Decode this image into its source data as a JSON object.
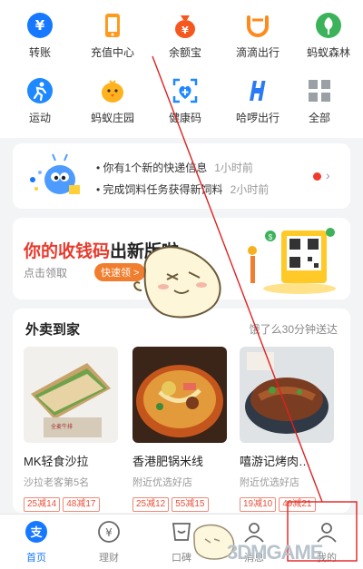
{
  "apps_row1": [
    {
      "label": "转账",
      "icon": "transfer-icon"
    },
    {
      "label": "充值中心",
      "icon": "phone-recharge-icon"
    },
    {
      "label": "余额宝",
      "icon": "money-bag-icon"
    },
    {
      "label": "滴滴出行",
      "icon": "didi-icon"
    },
    {
      "label": "蚂蚁森林",
      "icon": "forest-icon"
    }
  ],
  "apps_row2": [
    {
      "label": "运动",
      "icon": "sport-icon"
    },
    {
      "label": "蚂蚁庄园",
      "icon": "chick-icon"
    },
    {
      "label": "健康码",
      "icon": "health-code-icon"
    },
    {
      "label": "哈啰出行",
      "icon": "hello-icon"
    },
    {
      "label": "全部",
      "icon": "all-grid-icon"
    }
  ],
  "messages": [
    {
      "text": "你有1个新的快递信息",
      "time": "1小时前"
    },
    {
      "text": "完成饲料任务获得新饲料",
      "time": "2小时前"
    }
  ],
  "promo": {
    "title_colored": "你的收钱码",
    "title_plain": "出新版啦",
    "subtitle": "点击领取",
    "button": "快速领 >"
  },
  "food": {
    "title": "外卖到家",
    "subtitle": "饿了么30分钟送达",
    "items": [
      {
        "name": "MK轻食沙拉",
        "shop": "沙拉老客第5名",
        "tags": [
          "25减14",
          "48减17"
        ]
      },
      {
        "name": "香港肥锅米线",
        "shop": "附近优选好店",
        "tags": [
          "25减12",
          "55减15"
        ]
      },
      {
        "name": "嘻游记烤肉…",
        "shop": "附近优选好店",
        "tags": [
          "19减10",
          "49减21"
        ]
      }
    ]
  },
  "tabbar": [
    {
      "label": "首页",
      "icon": "home-icon"
    },
    {
      "label": "理财",
      "icon": "wealth-icon"
    },
    {
      "label": "口碑",
      "icon": "koubei-icon"
    },
    {
      "label": "消息",
      "icon": "message-icon"
    },
    {
      "label": "我的",
      "icon": "profile-icon"
    }
  ],
  "watermark": "3DMGAME",
  "colors": {
    "brand": "#1677ff",
    "promo_red": "#e83a2c",
    "annotation": "#e02020"
  }
}
